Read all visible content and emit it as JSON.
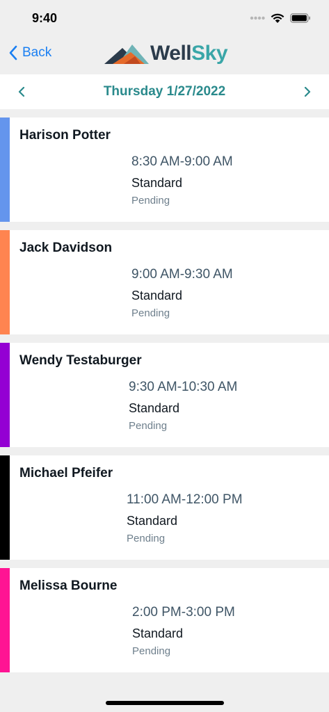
{
  "status_bar": {
    "time": "9:40"
  },
  "nav": {
    "back_label": "Back",
    "logo_well": "Well",
    "logo_sky": "Sky"
  },
  "date_header": {
    "title": "Thursday 1/27/2022"
  },
  "colors": {
    "accent_blue": "#1a7ff2",
    "teal": "#2a8a8c",
    "card_colors": [
      "#6495ed",
      "#ff8450",
      "#9400d3",
      "#000000",
      "#ff1493"
    ]
  },
  "visits": [
    {
      "name": "Harison Potter",
      "time": "8:30 AM-9:00 AM",
      "type": "Standard",
      "status": "Pending"
    },
    {
      "name": "Jack Davidson",
      "time": "9:00 AM-9:30 AM",
      "type": "Standard",
      "status": "Pending"
    },
    {
      "name": "Wendy Testaburger",
      "time": "9:30 AM-10:30 AM",
      "type": "Standard",
      "status": "Pending"
    },
    {
      "name": "Michael Pfeifer",
      "time": "11:00 AM-12:00 PM",
      "type": "Standard",
      "status": "Pending"
    },
    {
      "name": "Melissa Bourne",
      "time": "2:00 PM-3:00 PM",
      "type": "Standard",
      "status": "Pending"
    }
  ]
}
